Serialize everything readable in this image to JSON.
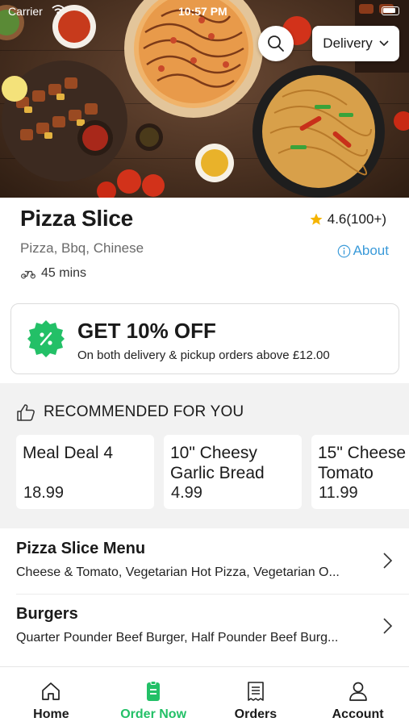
{
  "status_bar": {
    "carrier": "Carrier",
    "time": "10:57 PM"
  },
  "header": {
    "delivery_label": "Delivery"
  },
  "restaurant": {
    "name": "Pizza Slice",
    "rating": "4.6(100+)",
    "cuisines": "Pizza, Bbq, Chinese",
    "about_label": "About",
    "eta": "45 mins"
  },
  "offer": {
    "title": "GET 10% OFF",
    "subtitle": "On both delivery & pickup orders above £12.00"
  },
  "recommended": {
    "heading": "RECOMMENDED FOR YOU",
    "items": [
      {
        "name": "Meal Deal 4",
        "price": "18.99"
      },
      {
        "name": "10\" Cheesy Garlic Bread",
        "price": "4.99"
      },
      {
        "name": "15\" Cheese Tomato",
        "price": "11.99"
      }
    ]
  },
  "menu": [
    {
      "title": "Pizza Slice Menu",
      "description": "Cheese & Tomato, Vegetarian Hot Pizza, Vegetarian O..."
    },
    {
      "title": "Burgers",
      "description": "Quarter Pounder Beef Burger, Half Pounder Beef Burg..."
    }
  ],
  "tabs": [
    {
      "label": "Home",
      "icon": "home-icon",
      "active": false
    },
    {
      "label": "Order Now",
      "icon": "order-icon",
      "active": true
    },
    {
      "label": "Orders",
      "icon": "receipt-icon",
      "active": false
    },
    {
      "label": "Account",
      "icon": "user-icon",
      "active": false
    }
  ],
  "colors": {
    "accent": "#23c067",
    "link": "#3a9ad9",
    "star": "#f5b400"
  }
}
